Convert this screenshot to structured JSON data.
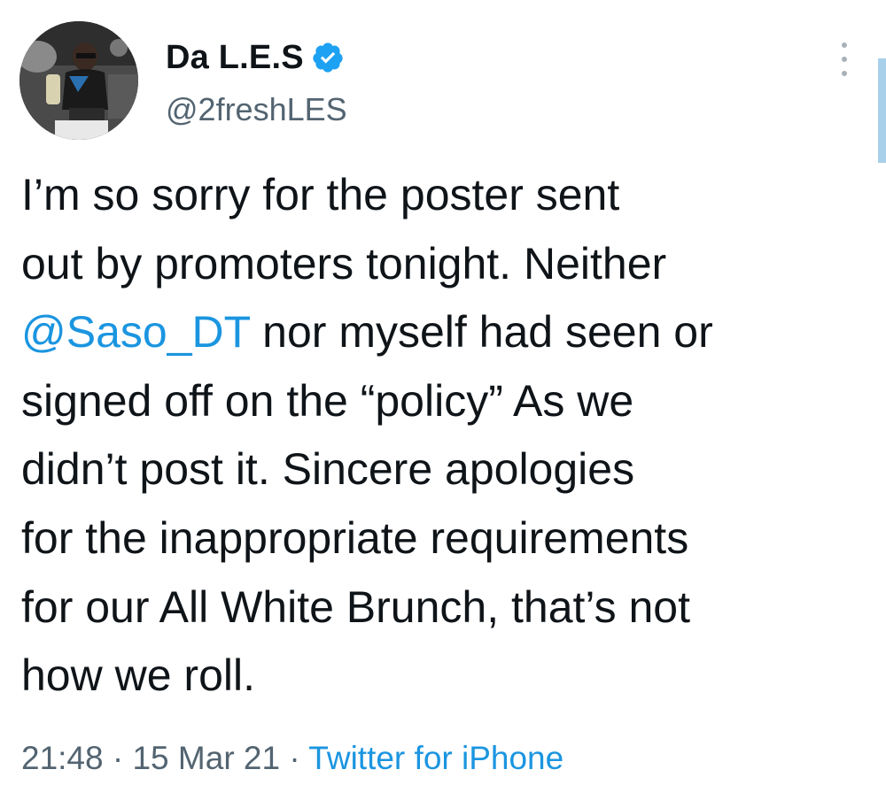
{
  "tweet": {
    "author": {
      "display_name": "Da L.E.S",
      "handle": "@2freshLES",
      "verified": true,
      "avatar": "profile-photo"
    },
    "text": {
      "line1": "I’m so sorry for the poster sent",
      "line2": "out by promoters tonight. Neither",
      "mention": "@Saso_DT",
      "line3_rest": " nor myself had seen or",
      "line4": "signed off on the “policy”  As we",
      "line5": "didn’t post it. Sincere apologies",
      "line6": "for the inappropriate requirements",
      "line7": "for our All White Brunch, that’s not",
      "line8": "how we roll."
    },
    "meta": {
      "time": "21:48",
      "separator1": " · ",
      "date": "15 Mar 21",
      "separator2": " · ",
      "source": "Twitter for iPhone"
    }
  },
  "icons": {
    "verified": "verified-badge-icon",
    "more": "more-vertical-icon"
  },
  "colors": {
    "link": "#1b95e0",
    "secondary": "#536471",
    "text": "#0f1419",
    "verified": "#1da1f2"
  }
}
